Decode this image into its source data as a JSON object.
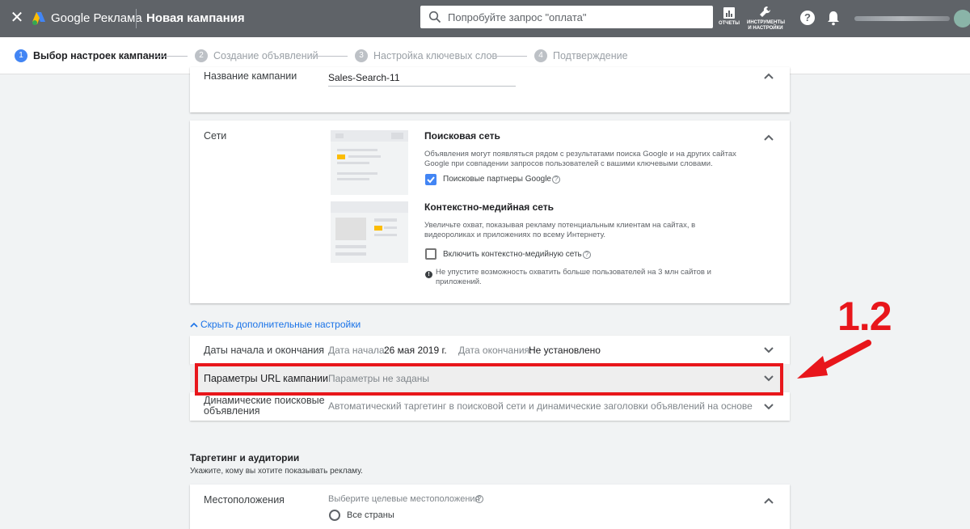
{
  "header": {
    "brand": "Google Реклама",
    "campaign_title": "Новая кампания",
    "search_placeholder": "Попробуйте запрос \"оплата\"",
    "reports_label": "ОТЧЕТЫ",
    "tools_label_1": "ИНСТРУМЕНТЫ",
    "tools_label_2": "И НАСТРОЙКИ"
  },
  "stepper": {
    "steps": [
      {
        "num": "1",
        "label": "Выбор настроек кампании"
      },
      {
        "num": "2",
        "label": "Создание объявлений"
      },
      {
        "num": "3",
        "label": "Настройка ключевых слов"
      },
      {
        "num": "4",
        "label": "Подтверждение"
      }
    ]
  },
  "campaign_name": {
    "label": "Название кампании",
    "value": "Sales-Search-11"
  },
  "networks": {
    "label": "Сети",
    "search_title": "Поисковая сеть",
    "search_desc_1": "Объявления могут появляться рядом с результатами поиска Google и на других сайтах",
    "search_desc_2": "Google при совпадении запросов пользователей с вашими ключевыми словами.",
    "search_partners": "Поисковые партнеры Google",
    "display_title": "Контекстно-медийная сеть",
    "display_desc_1": "Увеличьте охват, показывая рекламу потенциальным клиентам на сайтах, в",
    "display_desc_2": "видеороликах и приложениях по всему Интернету.",
    "display_include": "Включить контекстно-медийную сеть",
    "display_note_1": "Не упустите возможность охватить больше пользователей на 3 млн сайтов и",
    "display_note_2": "приложений."
  },
  "advanced": {
    "toggle": "Скрыть дополнительные настройки",
    "dates_label": "Даты начала и окончания",
    "start_label": "Дата начала:",
    "start_value": "26 мая 2019 г.",
    "end_label": "Дата окончания:",
    "end_value": "Не установлено",
    "url_label": "Параметры URL кампании",
    "url_value": "Параметры не заданы",
    "dsa_label_1": "Динамические поисковые",
    "dsa_label_2": "объявления",
    "dsa_value": "Автоматический таргетинг в поисковой сети и динамические заголовки объявлений на основе вашег"
  },
  "targeting": {
    "title": "Таргетинг и аудитории",
    "subtitle": "Укажите, кому вы хотите показывать рекламу.",
    "locations_label": "Местоположения",
    "locations_hint": "Выберите целевые местоположения",
    "all_countries": "Все страны"
  },
  "annotation": {
    "label": "1.2",
    "color": "#e8161b"
  },
  "colors": {
    "topbar": "#5f6368",
    "accent": "#4285f4",
    "link": "#1a73e8"
  }
}
